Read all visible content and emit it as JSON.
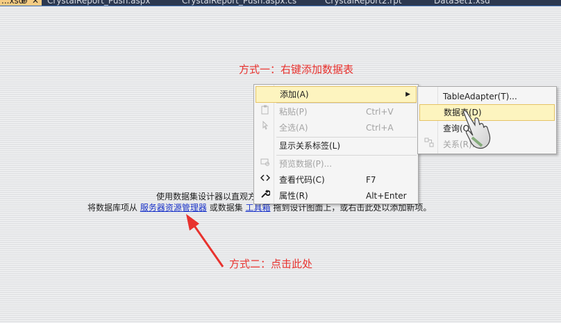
{
  "tabs": [
    {
      "label": "...xsd",
      "active": true,
      "pin": "⊕",
      "close": "✕"
    },
    {
      "label": "CrystalReport_Push.aspx"
    },
    {
      "label": "CrystalReport_Push.aspx.cs"
    },
    {
      "label": "CrystalReport2.rpt"
    },
    {
      "label": "DataSet1.xsd"
    }
  ],
  "annotations": {
    "method1": "方式一：右键添加数据表",
    "method2": "方式二：点击此处"
  },
  "hint": {
    "line1": "使用数据集设计器以直观方",
    "line2_prefix": "将数据库项从",
    "link1": "服务器资源管理器",
    "line2_mid": "或数据集",
    "link2": "工具箱",
    "line2_suffix": "拖到设计图面上，或右击此处以添加新项。"
  },
  "context_menu": {
    "items": [
      {
        "label": "添加(A)",
        "icon": "",
        "shortcut": "",
        "highlighted": true,
        "submenu_arrow": "▶"
      },
      {
        "label": "粘贴(P)",
        "icon": "paste-icon",
        "shortcut": "Ctrl+V",
        "disabled": true
      },
      {
        "label": "全选(A)",
        "icon": "select-all-icon",
        "shortcut": "Ctrl+A",
        "disabled": true
      },
      {
        "label": "显示关系标签(L)",
        "icon": "",
        "shortcut": ""
      },
      {
        "label": "预览数据(P)...",
        "icon": "preview-data-icon",
        "shortcut": "",
        "disabled": true
      },
      {
        "label": "查看代码(C)",
        "icon": "code-icon",
        "shortcut": "F7"
      },
      {
        "label": "属性(R)",
        "icon": "wrench-icon",
        "shortcut": "Alt+Enter"
      }
    ],
    "submenu": [
      {
        "label": "TableAdapter(T)..."
      },
      {
        "label": "数据表(D)",
        "highlighted": true
      },
      {
        "label": "查询(Q)..."
      },
      {
        "label": "关系(R)...",
        "icon": "relation-icon",
        "disabled": true
      }
    ]
  },
  "colors": {
    "annotation": "#e8322e",
    "link": "#1a33c8",
    "highlight_bg": "#fdf4bf",
    "active_tab": "#f5cc84"
  }
}
